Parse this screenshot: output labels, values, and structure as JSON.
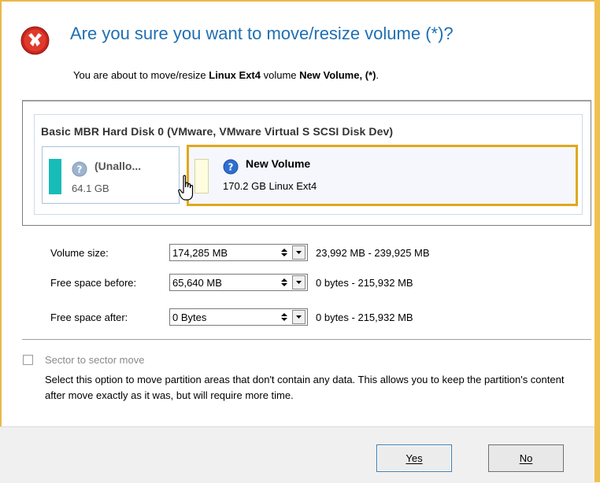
{
  "dialog": {
    "title": "Are you sure you want to move/resize volume (*)?",
    "subtitle_prefix": "You are about to move/resize ",
    "subtitle_fs": "Linux Ext4",
    "subtitle_mid": " volume ",
    "subtitle_volume": "New Volume, (*)",
    "subtitle_suffix": "."
  },
  "disk": {
    "title": "Basic MBR Hard Disk 0 (VMware, VMware Virtual S SCSI Disk Dev)",
    "partitions": [
      {
        "name": "(Unallo...",
        "size": "64.1 GB",
        "color": "#17bcb8"
      },
      {
        "name": "New Volume",
        "size": "170.2 GB Linux Ext4",
        "color": "#fffde0",
        "selected": true
      }
    ]
  },
  "fields": {
    "volume_size": {
      "label": "Volume size:",
      "value": "174,285 MB",
      "range": "23,992 MB - 239,925 MB"
    },
    "free_before": {
      "label": "Free space before:",
      "value": "65,640 MB",
      "range": "0 bytes - 215,932 MB"
    },
    "free_after": {
      "label": "Free space after:",
      "value": "0 Bytes",
      "range": "0 bytes - 215,932 MB"
    }
  },
  "sector_move": {
    "label": "Sector to sector move",
    "checked": false,
    "description": "Select this option to move partition areas that don't contain any data. This allows you to keep the partition's content after move exactly as it was, but will require more time."
  },
  "buttons": {
    "yes": "Yes",
    "no": "No"
  },
  "colors": {
    "title": "#1f6fb3",
    "selection_border": "#e1a81d",
    "unallocated": "#17bcb8"
  }
}
